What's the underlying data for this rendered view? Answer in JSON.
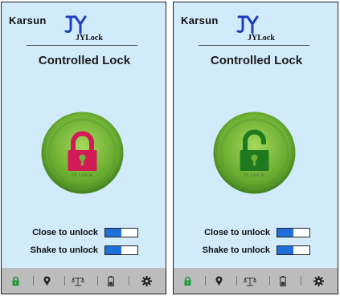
{
  "screens": [
    {
      "brand": "Karsun",
      "logo_text": "JYLock",
      "title": "Controlled Lock",
      "lock_badge": "JY LOCK",
      "lock_state": "locked",
      "lock_color": "#d21a57",
      "toggles": [
        {
          "label": "Close to unlock",
          "fill": 0.5
        },
        {
          "label": "Shake to unlock",
          "fill": 0.5
        }
      ],
      "tabs": [
        "lock-icon",
        "location-pin-icon",
        "scale-icon",
        "battery-icon",
        "gear-icon"
      ]
    },
    {
      "brand": "Karsun",
      "logo_text": "JYLock",
      "title": "Controlled Lock",
      "lock_badge": "JY LOCK",
      "lock_state": "unlocked",
      "lock_color": "#1f7a1f",
      "toggles": [
        {
          "label": "Close to unlock",
          "fill": 0.5
        },
        {
          "label": "Shake to unlock",
          "fill": 0.5
        }
      ],
      "tabs": [
        "lock-icon",
        "location-pin-icon",
        "scale-icon",
        "battery-icon",
        "gear-icon"
      ]
    }
  ],
  "colors": {
    "screen_bg": "#d2ebfb",
    "logo_blue": "#1d3fbf",
    "toggle_blue": "#1e6fd9",
    "tabbar_bg": "#bcbcbc",
    "tab_icon_active": "#1f9a3a",
    "tab_icon": "#222222",
    "button_green": "#7cc242"
  }
}
